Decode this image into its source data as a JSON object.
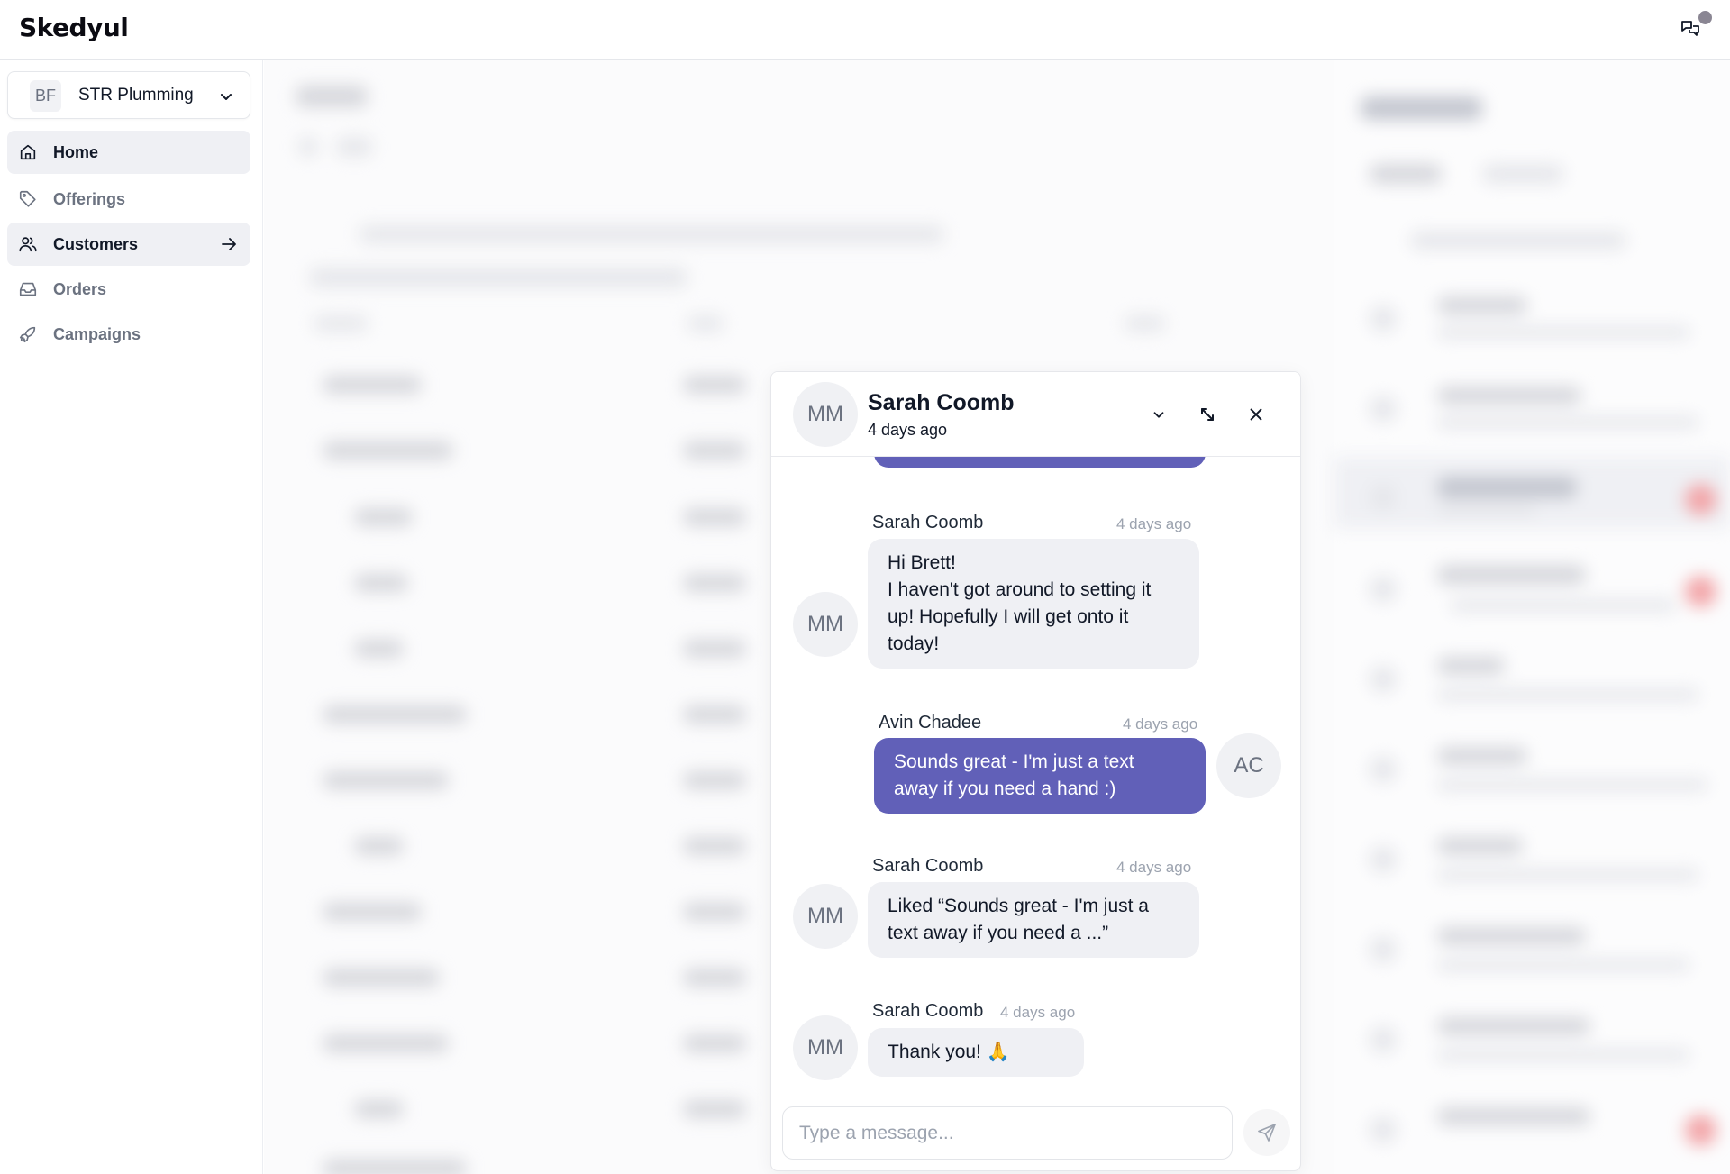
{
  "app": {
    "logo": "Skedyul"
  },
  "topbar": {
    "messages_icon": "chat-bubbles-icon",
    "unread_indicator": true
  },
  "sidebar": {
    "workspace": {
      "initials": "BF",
      "name": "STR Plumming"
    },
    "items": [
      {
        "label": "Home",
        "icon": "home-icon",
        "active": true
      },
      {
        "label": "Offerings",
        "icon": "tag-icon",
        "active": false
      },
      {
        "label": "Customers",
        "icon": "users-icon",
        "active": true,
        "trailing_icon": "arrow-right-icon"
      },
      {
        "label": "Orders",
        "icon": "inbox-icon",
        "active": false
      },
      {
        "label": "Campaigns",
        "icon": "rocket-icon",
        "active": false
      }
    ]
  },
  "chat": {
    "header": {
      "avatar_initials": "MM",
      "name": "Sarah Coomb",
      "subtitle": "4 days ago"
    },
    "messages": [
      {
        "direction": "in",
        "sender": "Sarah Coomb",
        "avatar": "MM",
        "time": "4 days ago",
        "lines": [
          "Hi Brett!",
          "I haven't got around to setting it",
          "up! Hopefully I will get onto it",
          "today!"
        ]
      },
      {
        "direction": "out",
        "sender": "Avin Chadee",
        "avatar": "AC",
        "time": "4 days ago",
        "lines": [
          "Sounds great - I'm just a text",
          "away if you need a hand :)"
        ]
      },
      {
        "direction": "in",
        "sender": "Sarah Coomb",
        "avatar": "MM",
        "time": "4 days ago",
        "lines": [
          "Liked “Sounds great - I'm just a",
          "text away if you need a ...”"
        ]
      },
      {
        "direction": "in",
        "sender": "Sarah Coomb",
        "avatar": "MM",
        "time": "4 days ago",
        "lines": [
          "Thank you! 🙏"
        ]
      }
    ],
    "composer": {
      "placeholder": "Type a message...",
      "value": ""
    }
  },
  "colors": {
    "accent": "#6160b8",
    "incoming_bubble": "#eff0f4",
    "active_nav": "#eff0f4",
    "unread_dot": "#8a8693"
  }
}
